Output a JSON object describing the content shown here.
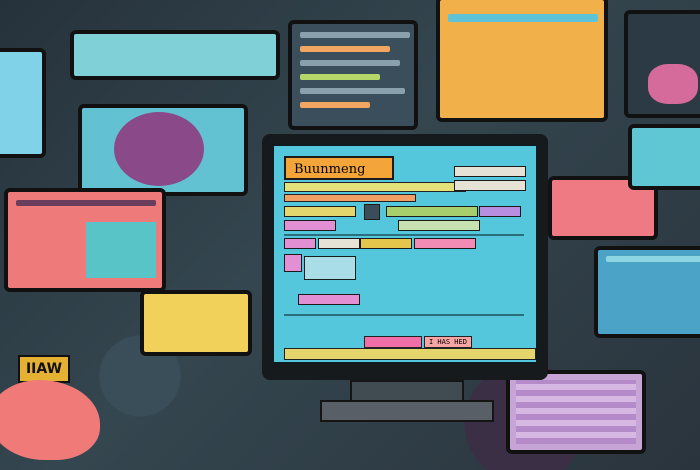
{
  "main_monitor": {
    "title": "Buunmeng",
    "footer_label": "I HAS HED"
  },
  "side_sign": {
    "text": "IIAW"
  },
  "colors": {
    "main_screen": "#54c7dd",
    "accent_orange": "#f4a53a",
    "accent_pink": "#f7a4a4"
  }
}
